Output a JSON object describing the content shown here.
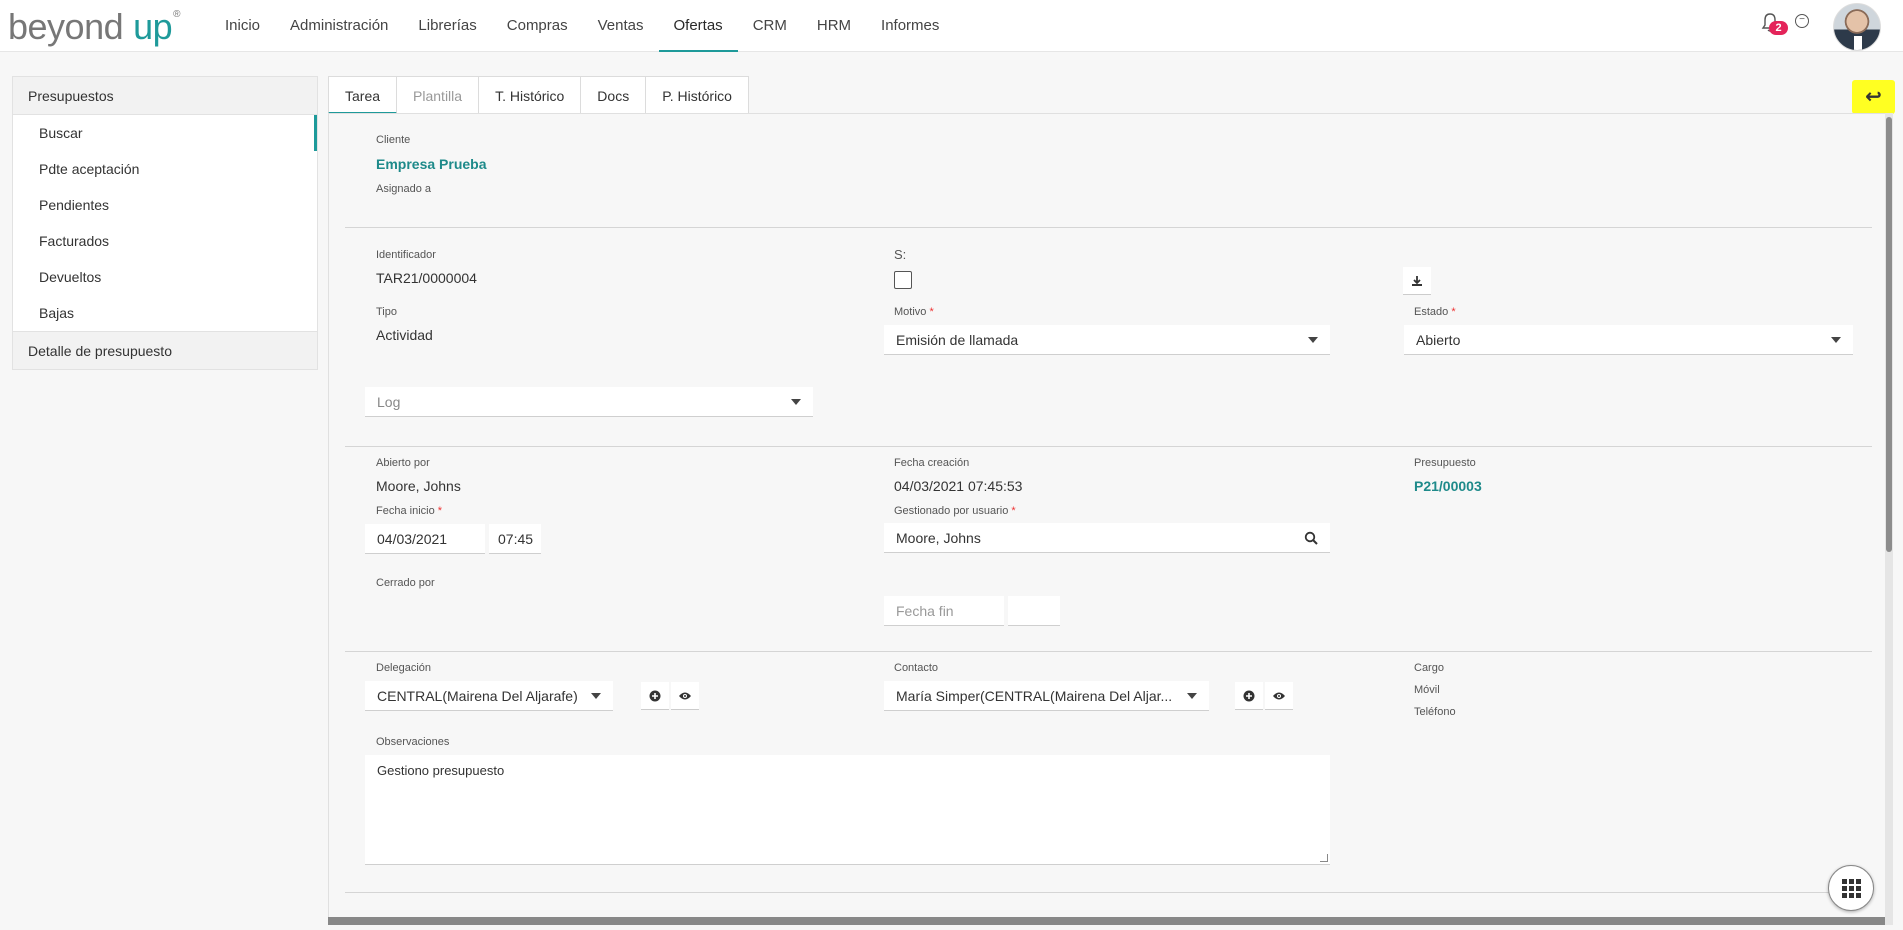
{
  "app": {
    "logo_left": "beyond",
    "logo_right": "up",
    "logo_reg": "®"
  },
  "nav": [
    "Inicio",
    "Administración",
    "Librerías",
    "Compras",
    "Ventas",
    "Ofertas",
    "CRM",
    "HRM",
    "Informes"
  ],
  "nav_active": "Ofertas",
  "notifications": {
    "count": "2"
  },
  "sidebar": {
    "header": "Presupuestos",
    "items": [
      "Buscar",
      "Pdte aceptación",
      "Pendientes",
      "Facturados",
      "Devueltos",
      "Bajas"
    ],
    "active": "Buscar",
    "footer": "Detalle de presupuesto"
  },
  "tabs": [
    "Tarea",
    "Plantilla",
    "T. Histórico",
    "Docs",
    "P. Histórico"
  ],
  "form": {
    "cliente_label": "Cliente",
    "cliente_value": "Empresa Prueba",
    "asignado_label": "Asignado a",
    "identificador_label": "Identificador",
    "identificador_value": "TAR21/0000004",
    "s_label": "S:",
    "tipo_label": "Tipo",
    "tipo_value": "Actividad",
    "motivo_label": "Motivo",
    "motivo_value": "Emisión de llamada",
    "estado_label": "Estado",
    "estado_value": "Abierto",
    "log_placeholder": "Log",
    "abierto_por_label": "Abierto por",
    "abierto_por_value": "Moore, Johns",
    "fecha_creacion_label": "Fecha creación",
    "fecha_creacion_value": "04/03/2021 07:45:53",
    "presupuesto_label": "Presupuesto",
    "presupuesto_value": "P21/00003",
    "fecha_inicio_label": "Fecha inicio",
    "fecha_inicio_date": "04/03/2021",
    "fecha_inicio_time": "07:45",
    "gestionado_label": "Gestionado por usuario",
    "gestionado_value": "Moore, Johns",
    "cerrado_por_label": "Cerrado por",
    "fecha_fin_placeholder": "Fecha fin",
    "delegacion_label": "Delegación",
    "delegacion_value": "CENTRAL(Mairena Del Aljarafe)",
    "contacto_label": "Contacto",
    "contacto_value": "María Simper(CENTRAL(Mairena Del Aljar...",
    "cargo_label": "Cargo",
    "movil_label": "Móvil",
    "telefono_label": "Teléfono",
    "observaciones_label": "Observaciones",
    "observaciones_value": "Gestiono presupuesto",
    "required_mark": "*"
  },
  "icons": [
    "bell-icon",
    "settings-circle-icon",
    "back-arrow-icon",
    "download-icon",
    "search-icon",
    "plus-circle-icon",
    "eye-icon",
    "apps-grid-icon"
  ],
  "colors": {
    "accent": "#1e9a9a",
    "badge": "#e4245a",
    "highlight": "#ffff22"
  }
}
